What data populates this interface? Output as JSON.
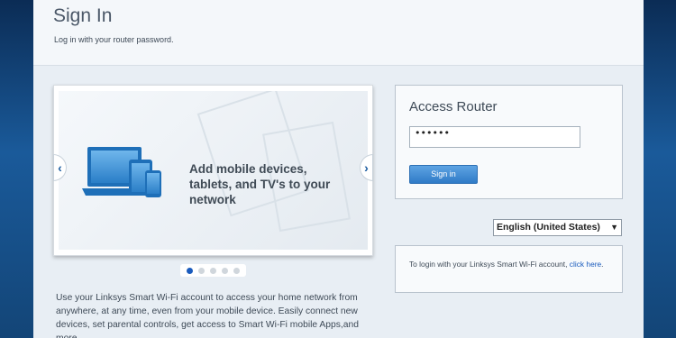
{
  "header": {
    "title": "Sign In",
    "subtitle": "Log in with your router password."
  },
  "carousel": {
    "slide_text": "Add mobile devices, tablets, and TV's to your network",
    "prev_icon": "‹",
    "next_icon": "›",
    "dot_count": 5,
    "active_dot": 0
  },
  "description": "Use your Linksys Smart Wi-Fi account to access your home network from anywhere, at any time, even from your mobile device. Easily connect new devices, set parental controls, get access to Smart Wi-Fi mobile Apps,and more.",
  "login": {
    "title": "Access Router",
    "password_value": "••••••",
    "signin_label": "Sign in"
  },
  "language": {
    "selected": "English (United States)"
  },
  "info": {
    "text": "To login with your Linksys Smart Wi-Fi account, ",
    "link_text": "click here",
    "suffix": "."
  },
  "colors": {
    "accent": "#1a5bbd",
    "button": "#2f7bc7",
    "background_edge": "#1b4f86"
  }
}
